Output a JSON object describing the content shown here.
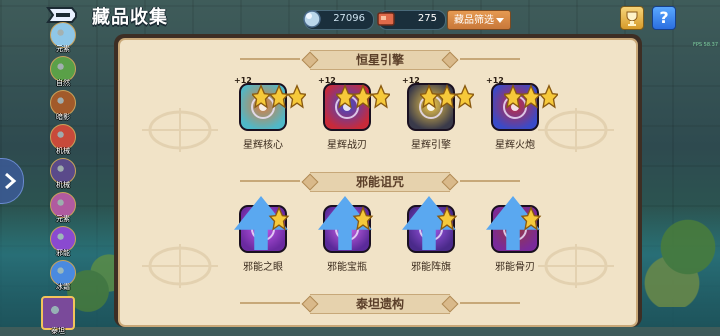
{
  "header": {
    "title": "藏品收集",
    "gem_value": "27096",
    "ore_value": "275",
    "filter_label": "藏品筛选",
    "help_label": "?"
  },
  "corner_text": "FPS 58.37",
  "sidebar": {
    "categories": [
      {
        "label": "元素",
        "color": "#8fc7e8"
      },
      {
        "label": "自然",
        "color": "#5aa048"
      },
      {
        "label": "暗影",
        "color": "#a25a2a"
      },
      {
        "label": "机械",
        "color": "#c84a3a"
      },
      {
        "label": "机械",
        "color": "#5a4a8a"
      },
      {
        "label": "元素",
        "color": "#b05aa0"
      },
      {
        "label": "邪能",
        "color": "#8a4ad0"
      },
      {
        "label": "冰霜",
        "color": "#4a8ae0"
      },
      {
        "label": "泰坦",
        "color": "#7a4a9a"
      }
    ]
  },
  "sections": [
    {
      "title": "恒星引擎",
      "items": [
        {
          "name": "星辉核心",
          "level": "+12",
          "stars": 3,
          "primary": "#4fb8c8",
          "accent": "#e07a3a"
        },
        {
          "name": "星辉战刃",
          "level": "+12",
          "stars": 3,
          "primary": "#c82a3a",
          "accent": "#3a4ad0"
        },
        {
          "name": "星辉引擎",
          "level": "+12",
          "stars": 3,
          "primary": "#3a3a4a",
          "accent": "#f0c84a"
        },
        {
          "name": "星辉火炮",
          "level": "+12",
          "stars": 3,
          "primary": "#3a4ac8",
          "accent": "#c82a3a"
        }
      ]
    },
    {
      "title": "邪能诅咒",
      "items": [
        {
          "name": "邪能之眼",
          "level": "",
          "stars": 1,
          "primary": "#6a2aa0",
          "accent": "#c85af0"
        },
        {
          "name": "邪能宝瓶",
          "level": "",
          "stars": 1,
          "primary": "#5a2a9a",
          "accent": "#d86af0"
        },
        {
          "name": "邪能阵旗",
          "level": "",
          "stars": 1,
          "primary": "#4a2a8a",
          "accent": "#a85af0"
        },
        {
          "name": "邪能骨刃",
          "level": "",
          "stars": 1,
          "primary": "#7a2a9a",
          "accent": "#9a3a3a"
        }
      ]
    },
    {
      "title": "泰坦遗构",
      "items": []
    }
  ],
  "colors": {
    "panel_bg": "#f1e3c7",
    "panel_border": "#c9a878",
    "filter_button": "#d8883f"
  }
}
